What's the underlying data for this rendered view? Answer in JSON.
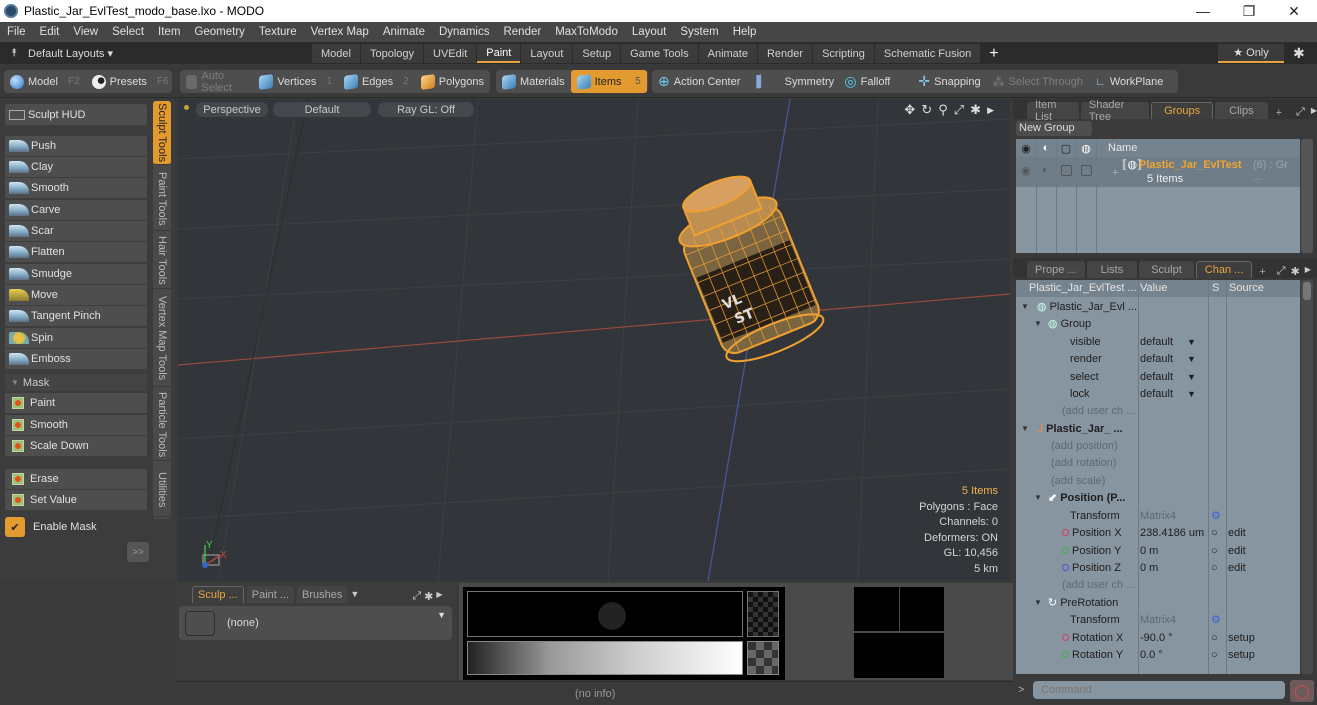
{
  "window": {
    "title": "Plastic_Jar_EvlTest_modo_base.lxo - MODO",
    "minimize": "—",
    "maximize": "❐",
    "close": "✕"
  },
  "menu": [
    "File",
    "Edit",
    "View",
    "Select",
    "Item",
    "Geometry",
    "Texture",
    "Vertex Map",
    "Animate",
    "Dynamics",
    "Render",
    "MaxToModo",
    "Layout",
    "System",
    "Help"
  ],
  "layouts": {
    "label": "Default Layouts ▾",
    "tabs": [
      "Model",
      "Topology",
      "UVEdit",
      "Paint",
      "Layout",
      "Setup",
      "Game Tools",
      "Animate",
      "Render",
      "Scripting",
      "Schematic Fusion"
    ],
    "active": "Paint",
    "add": "+",
    "only": "★ Only"
  },
  "toolbar": {
    "model": {
      "label": "Model",
      "key": "F2"
    },
    "presets": {
      "label": "Presets",
      "key": "F6"
    },
    "auto_select": "Auto Select",
    "vertices": {
      "label": "Vertices",
      "key": "1"
    },
    "edges": {
      "label": "Edges",
      "key": "2"
    },
    "polygons": "Polygons",
    "materials": "Materials",
    "items": {
      "label": "Items",
      "key": "5"
    },
    "action_center": "Action Center",
    "symmetry": "Symmetry",
    "falloff": "Falloff",
    "snapping": "Snapping",
    "select_through": "Select Through",
    "workplane": "WorkPlane"
  },
  "left_panel": {
    "sculpt_hud": "Sculpt HUD",
    "tools": [
      "Push",
      "Clay",
      "Smooth",
      "Carve",
      "Scar",
      "Flatten",
      "Smudge",
      "Move",
      "Tangent Pinch",
      "Spin",
      "Emboss"
    ],
    "mask_header": "Mask",
    "mask_tools": [
      "Paint",
      "Smooth",
      "Scale Down"
    ],
    "mask_tools2": [
      "Erase",
      "Set Value"
    ],
    "enable_mask": "Enable Mask",
    "enable_mask_checked": true,
    "more": ">>",
    "vertical_tabs": [
      "Sculpt Tools",
      "Paint Tools",
      "Hair Tools",
      "Vertex Map Tools",
      "Particle Tools",
      "Utilities"
    ]
  },
  "viewport": {
    "view": "Perspective",
    "shading": "Default",
    "raygl": "Ray GL: Off",
    "info": {
      "items": "5 Items",
      "polygons": "Polygons : Face",
      "channels": "Channels: 0",
      "deformers": "Deformers: ON",
      "gl": "GL: 10,456",
      "scale": "5 km"
    },
    "axis": {
      "y": "Y",
      "x": "X"
    }
  },
  "groups_panel": {
    "tabs": [
      "Item List",
      "Shader Tree",
      "Groups",
      "Clips"
    ],
    "active": "Groups",
    "new_group": "New Group",
    "col_name": "Name",
    "group_name": "Plastic_Jar_EvlTest",
    "group_suffix": "(6) : Gr ...",
    "group_count": "5 Items"
  },
  "channels_panel": {
    "tabs": [
      "Prope ...",
      "Lists",
      "Sculpt",
      "Chan ..."
    ],
    "active": "Chan ...",
    "headers": {
      "name": "Plastic_Jar_EvlTest ...",
      "value": "Value",
      "s": "S",
      "source": "Source"
    },
    "rows": [
      {
        "name": "Plastic_Jar_Evl ...",
        "value": "",
        "source": ""
      },
      {
        "name": "Group",
        "value": "",
        "source": ""
      },
      {
        "name": "visible",
        "value": "default",
        "source": ""
      },
      {
        "name": "render",
        "value": "default",
        "source": ""
      },
      {
        "name": "select",
        "value": "default",
        "source": ""
      },
      {
        "name": "lock",
        "value": "default",
        "source": ""
      },
      {
        "name": "(add user ch ...",
        "value": "",
        "source": ""
      },
      {
        "name": "Plastic_Jar_ ...",
        "value": "",
        "source": ""
      },
      {
        "name": "(add position)",
        "value": "",
        "source": ""
      },
      {
        "name": "(add rotation)",
        "value": "",
        "source": ""
      },
      {
        "name": "(add scale)",
        "value": "",
        "source": ""
      },
      {
        "name": "Position (P...",
        "value": "",
        "source": ""
      },
      {
        "name": "Transform",
        "value": "Matrix4",
        "source": ""
      },
      {
        "name": "Position X",
        "value": "238.4186 um",
        "source": "edit"
      },
      {
        "name": "Position Y",
        "value": "0 m",
        "source": "edit"
      },
      {
        "name": "Position Z",
        "value": "0 m",
        "source": "edit"
      },
      {
        "name": "(add user ch ...",
        "value": "",
        "source": ""
      },
      {
        "name": "PreRotation",
        "value": "",
        "source": ""
      },
      {
        "name": "Transform",
        "value": "Matrix4",
        "source": ""
      },
      {
        "name": "Rotation X",
        "value": "-90.0 °",
        "source": "setup"
      },
      {
        "name": "Rotation Y",
        "value": "0.0 °",
        "source": "setup"
      }
    ]
  },
  "bottom_left": {
    "tabs": [
      "Sculp ...",
      "Paint ...",
      "Brushes"
    ],
    "active": "Sculp ...",
    "preset": "(none)"
  },
  "status": {
    "info": "(no info)"
  },
  "command": {
    "placeholder": "Command",
    "prompt": ">"
  },
  "colors": {
    "accent": "#e39a2e",
    "selected_text": "#f0b64a",
    "panel_bg": "#8795a1",
    "viewport_bg": "#32363a"
  }
}
